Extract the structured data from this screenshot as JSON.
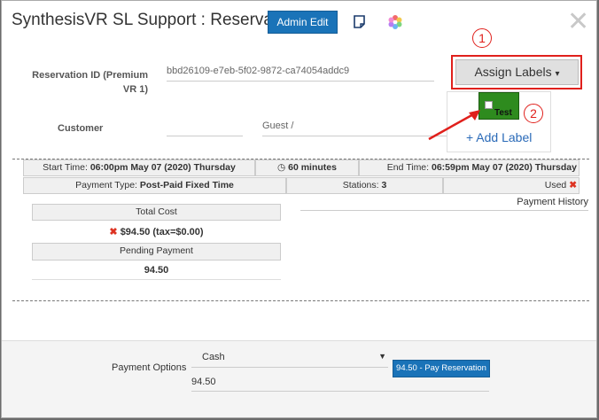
{
  "header": {
    "title": "SynthesisVR SL Support : Reservation",
    "admin_edit_label": "Admin Edit",
    "close_glyph": "✕"
  },
  "reservation": {
    "id_label": "Reservation ID (Premium VR 1)",
    "id_value": "bbd26109-e7eb-5f02-9872-ca74054addc9",
    "customer_label": "Customer",
    "customer_value": "Guest /"
  },
  "labels": {
    "assign_button": "Assign Labels",
    "caret": "▾",
    "options": [
      {
        "name": "Test",
        "color": "#2e8b1e",
        "checked": false
      }
    ],
    "add_label": "+ Add Label"
  },
  "annotations": [
    "1",
    "2"
  ],
  "schedule": {
    "start_label": "Start Time:",
    "start_value": "06:00pm May 07 (2020) Thursday",
    "duration": "60 minutes",
    "end_label": "End Time:",
    "end_value": "06:59pm May 07 (2020) Thursday",
    "payment_type_label": "Payment Type:",
    "payment_type_value": "Post-Paid Fixed Time",
    "stations_label": "Stations:",
    "stations_value": "3",
    "used_label": "Used"
  },
  "costs": {
    "total_cost_label": "Total Cost",
    "total_cost_value": "$94.50 (tax=$0.00)",
    "pending_label": "Pending Payment",
    "pending_value": "94.50",
    "history_label": "Payment History"
  },
  "footer": {
    "payment_options_label": "Payment Options",
    "method_value": "Cash",
    "amount_value": "94.50",
    "pay_button": "94.50 - Pay Reservation"
  },
  "colors": {
    "primary": "#1a73b8",
    "annotation_red": "#e0201c",
    "label_green": "#2e8b1e",
    "link_blue": "#2a6ab8"
  }
}
